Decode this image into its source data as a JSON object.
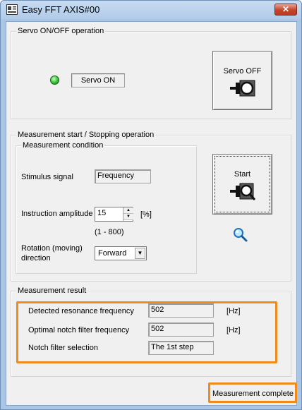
{
  "window": {
    "title": "Easy FFT AXIS#00",
    "close_label": "✕",
    "app_icon": "fft-window-icon"
  },
  "servo_group": {
    "legend": "Servo ON/OFF operation",
    "status_led_color": "#35c235",
    "status_text": "Servo ON",
    "servo_button_label": "Servo OFF",
    "servo_button_icon": "servo-motor-icon"
  },
  "measurement_group": {
    "legend": "Measurement start / Stopping operation",
    "condition": {
      "legend": "Measurement condition",
      "stimulus_label": "Stimulus signal",
      "stimulus_value": "Frequency",
      "amplitude_label": "Instruction amplitude",
      "amplitude_value": "15",
      "amplitude_unit": "[%]",
      "amplitude_range": "(1 - 800)",
      "rotation_label_line1": "Rotation (moving)",
      "rotation_label_line2": "direction",
      "rotation_value": "Forward"
    },
    "start_button_label": "Start",
    "start_button_icon": "motor-magnifier-icon",
    "search_icon": "magnifier-icon"
  },
  "result_group": {
    "legend": "Measurement result",
    "resonance_label": "Detected resonance frequency",
    "resonance_value": "502",
    "resonance_unit": "[Hz]",
    "notch_freq_label": "Optimal notch filter frequency",
    "notch_freq_value": "502",
    "notch_freq_unit": "[Hz]",
    "notch_sel_label": "Notch filter selection",
    "notch_sel_value": "The 1st step"
  },
  "status": {
    "message": "Measurement complete",
    "highlight_color": "#ef8a1c"
  }
}
